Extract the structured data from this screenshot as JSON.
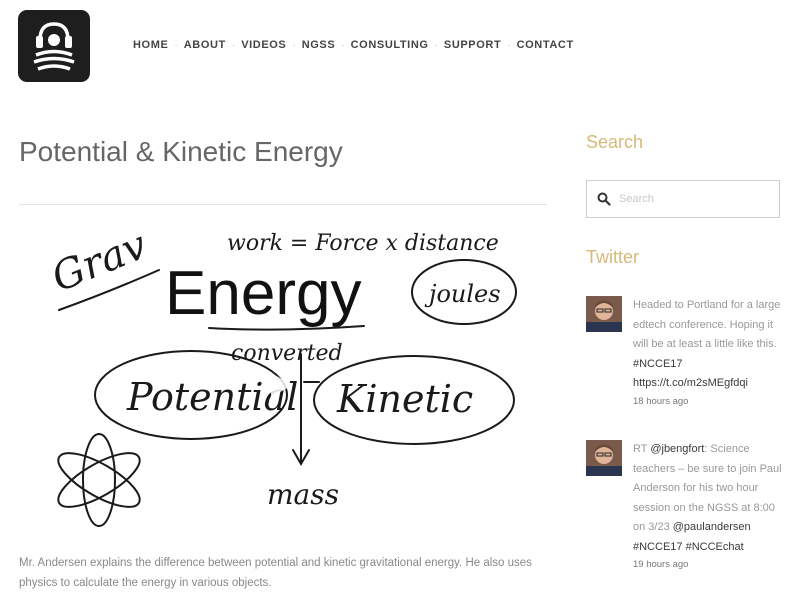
{
  "nav": {
    "items": [
      "HOME",
      "ABOUT",
      "VIDEOS",
      "NGSS",
      "CONSULTING",
      "SUPPORT",
      "CONTACT"
    ]
  },
  "page": {
    "title": "Potential & Kinetic Energy",
    "caption": "Mr. Andersen explains the difference between potential and kinetic gravitational energy. He also uses physics to calculate the energy in various objects."
  },
  "video": {
    "board": {
      "top": "work = Force x distance",
      "corner": "Grav",
      "title": "Energy",
      "unit": "joules",
      "converted": "converted",
      "left": "Potential",
      "right": "Kinetic",
      "below": "mass"
    }
  },
  "sidebar": {
    "search_heading": "Search",
    "search_placeholder": "Search",
    "twitter_heading": "Twitter",
    "tweets": [
      {
        "text_plain": "Headed to Portland for a large edtech conference. Hoping it will be at least a little like this. ",
        "hashtag": "#NCCE17",
        "link": "https://t.co/m2sMEgfdqi",
        "time": "18 hours ago"
      },
      {
        "rt": "RT ",
        "handle": "@jbengfort",
        "text_plain": ": Science teachers – be sure to join Paul Anderson for his two hour session on the NGSS at 8:00 on 3/23 ",
        "mention": "@paulandersen",
        "tags": " #NCCE17 #NCCEchat",
        "time": "19 hours ago"
      }
    ]
  },
  "colors": {
    "accent": "#d7b97a",
    "logo_bg": "#1e1e1e",
    "nav_text": "#444444",
    "title_text": "#666666",
    "muted_text": "#999999"
  }
}
